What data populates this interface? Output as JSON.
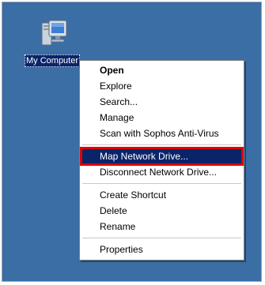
{
  "desktop": {
    "background_color": "#3a6ea5",
    "icon": {
      "label": "My Computer",
      "icon_name": "my-computer-icon"
    }
  },
  "context_menu": {
    "highlight_color": "#0a246a",
    "annotation_color": "#e00000",
    "items": {
      "open": "Open",
      "explore": "Explore",
      "search": "Search...",
      "manage": "Manage",
      "scan": "Scan with Sophos Anti-Virus",
      "map_drive": "Map Network Drive...",
      "disconnect_drive": "Disconnect Network Drive...",
      "create_shortcut": "Create Shortcut",
      "delete": "Delete",
      "rename": "Rename",
      "properties": "Properties"
    }
  }
}
